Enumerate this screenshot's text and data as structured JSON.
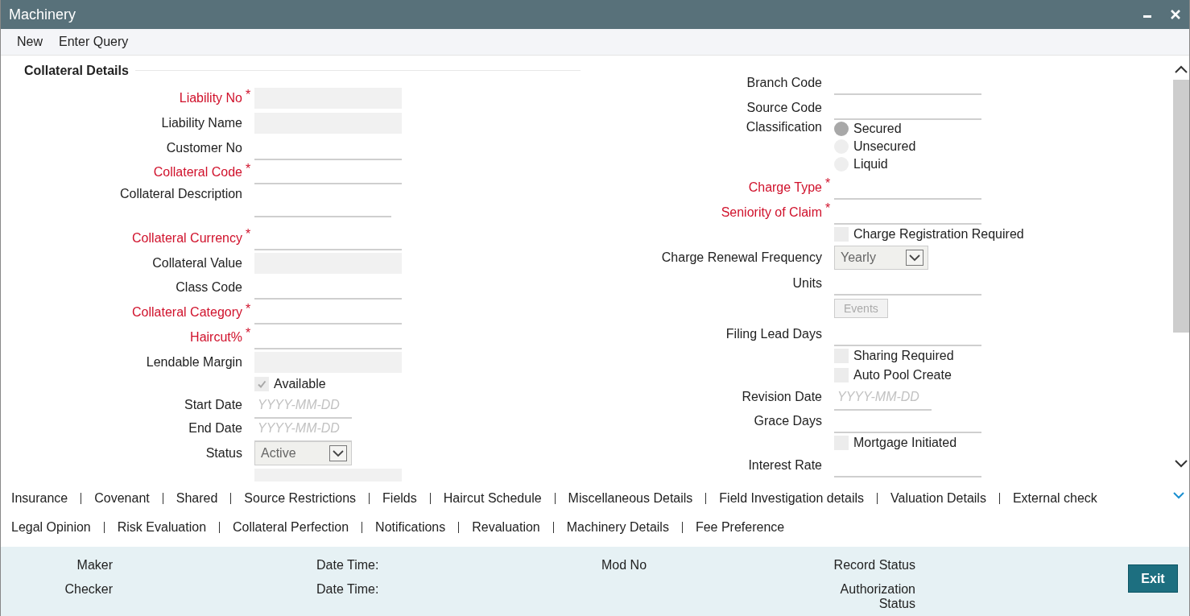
{
  "window": {
    "title": "Machinery"
  },
  "toolbar": [
    {
      "label": "New"
    },
    {
      "label": "Enter Query"
    }
  ],
  "section": {
    "title": "Collateral Details"
  },
  "left_fields": [
    {
      "kind": "text",
      "label": "Liability No",
      "asterisk": "*",
      "readonly": true
    },
    {
      "kind": "text",
      "label": "Liability Name",
      "readonly": true
    },
    {
      "kind": "text",
      "label": "Customer No",
      "readonly": false
    },
    {
      "kind": "text",
      "label": "Collateral Code",
      "asterisk": "*",
      "readonly": false
    },
    {
      "kind": "textarea",
      "label": "Collateral Description",
      "readonly": false
    },
    {
      "kind": "text",
      "label": "Collateral Currency",
      "asterisk": "*",
      "readonly": false
    },
    {
      "kind": "text",
      "label": "Collateral Value",
      "readonly": true
    },
    {
      "kind": "text",
      "label": "Class Code",
      "readonly": false
    },
    {
      "kind": "text",
      "label": "Collateral Category",
      "asterisk": "*",
      "readonly": false
    },
    {
      "kind": "text",
      "label": "Haircut%",
      "asterisk": "*",
      "readonly": false
    },
    {
      "kind": "text",
      "label": "Lendable Margin",
      "readonly": true
    },
    {
      "kind": "check",
      "label": "Available",
      "checked": true
    },
    {
      "kind": "date",
      "label": "Start Date",
      "placeholder": "YYYY-MM-DD"
    },
    {
      "kind": "date",
      "label": "End Date",
      "placeholder": "YYYY-MM-DD"
    },
    {
      "kind": "select",
      "label": "Status",
      "value": "Active"
    },
    {
      "kind": "blank",
      "readonly": true
    }
  ],
  "right_fields": [
    {
      "kind": "text",
      "label": "Branch Code",
      "readonly": false
    },
    {
      "kind": "text",
      "label": "Source Code",
      "readonly": false
    },
    {
      "kind": "radio",
      "label": "Classification",
      "options": [
        {
          "label": "Secured",
          "selected": true
        },
        {
          "label": "Unsecured",
          "selected": false
        },
        {
          "label": "Liquid",
          "selected": false
        }
      ]
    },
    {
      "kind": "text",
      "label": "Charge Type",
      "asterisk": "*",
      "readonly": false
    },
    {
      "kind": "text",
      "label": "Seniority of Claim",
      "asterisk": "*",
      "readonly": false
    },
    {
      "kind": "check",
      "label": "Charge Registration Required",
      "checked": false
    },
    {
      "kind": "select",
      "label": "Charge Renewal Frequency",
      "value": "Yearly"
    },
    {
      "kind": "text",
      "label": "Units",
      "readonly": false
    },
    {
      "kind": "button",
      "label": "Events",
      "disabled": true
    },
    {
      "kind": "text",
      "label": "Filing Lead Days",
      "readonly": false
    },
    {
      "kind": "check",
      "label": "Sharing Required",
      "checked": false
    },
    {
      "kind": "check",
      "label": "Auto Pool Create",
      "checked": false
    },
    {
      "kind": "date",
      "label": "Revision Date",
      "placeholder": "YYYY-MM-DD"
    },
    {
      "kind": "text",
      "label": "Grace Days",
      "readonly": false
    },
    {
      "kind": "check",
      "label": "Mortgage Initiated",
      "checked": false
    },
    {
      "kind": "text",
      "label": "Interest Rate",
      "readonly": false
    }
  ],
  "tab_links": [
    [
      "Insurance",
      "Covenant",
      "Shared",
      "Source Restrictions",
      "Fields",
      "Haircut Schedule",
      "Miscellaneous Details",
      "Field Investigation details",
      "Valuation Details",
      "External check"
    ],
    [
      "Legal Opinion",
      "Risk Evaluation",
      "Collateral Perfection",
      "Notifications",
      "Revaluation",
      "Machinery Details",
      "Fee Preference"
    ]
  ],
  "audit_columns": [
    {
      "labels": [
        "Maker",
        "Checker"
      ]
    },
    {
      "labels": [
        "Date Time:",
        "Date Time:"
      ]
    },
    {
      "labels": [
        "Mod No"
      ]
    },
    {
      "labels": [
        "Record Status",
        "Authorization Status"
      ]
    }
  ],
  "exit_button": {
    "label": "Exit"
  }
}
